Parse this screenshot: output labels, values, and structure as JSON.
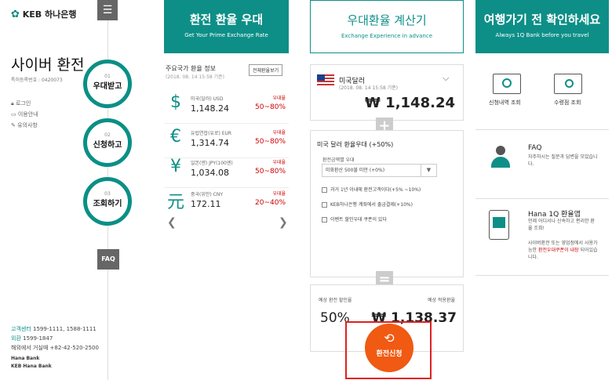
{
  "left": {
    "logo_text": "KEB 하나은행",
    "brand": "사이버 환전",
    "reg_no": "특허등록번호 : 0420073",
    "links": [
      "로그인",
      "이용안내",
      "유의사항"
    ],
    "steps": [
      {
        "num": "01",
        "label": "우대받고"
      },
      {
        "num": "02",
        "label": "신청하고"
      },
      {
        "num": "03",
        "label": "조회하기"
      }
    ],
    "faq": "FAQ",
    "contact": {
      "center_label": "고객센터",
      "center": "1599-1111, 1588-1111",
      "foreign_label": "외환",
      "foreign": "1599-1847",
      "overseas": "해외에서 거실때 +82-42-520-2500"
    },
    "hana_bank": "Hana Bank",
    "keb_hana_bank": "KEB Hana Bank"
  },
  "exchange": {
    "title": "환전 환율 우대",
    "subtitle": "Get Your Prime Exchange Rate",
    "rate_title": "주요국가 환율 정보",
    "rate_date": "(2018. 08. 14 15:58 기준)",
    "all_button": "전체환율보기",
    "rates": [
      {
        "symbol": "$",
        "currency": "미국(달러) USD",
        "value": "1,148.24",
        "label": "우대율",
        "pct": "50~80%"
      },
      {
        "symbol": "€",
        "currency": "유럽연합(유로) EUR",
        "value": "1,314.74",
        "label": "우대율",
        "pct": "50~80%"
      },
      {
        "symbol": "¥",
        "currency": "일본(엔) JPY(100엔)",
        "value": "1,034.08",
        "label": "우대율",
        "pct": "50~80%"
      },
      {
        "symbol": "元",
        "currency": "중국(위안) CNY",
        "value": "172.11",
        "label": "우대율",
        "pct": "20~40%"
      }
    ]
  },
  "calc": {
    "title": "우대환율 계산기",
    "subtitle": "Exchange Experience in advance",
    "currency": "미국달러",
    "date": "(2018. 08. 14 15:58 기준)",
    "rate": "₩ 1,148.24",
    "section_title": "미국 달러 환율우대 (+50%)",
    "amount_label": "환전금액별 우대",
    "select_value": "미화환산 500불 미만 (+0%)",
    "options": [
      "과거 1년 이내에 환전고객이다(+5% ~10%)",
      "KEB하나은행 계좌에서 출금결제(+10%)",
      "이벤트 할인우대 쿠폰이 있다"
    ],
    "discount_label": "예상 환전 할인율",
    "applied_label": "예상 적용환율",
    "discount": "50%",
    "applied": "₩ 1,138.37",
    "apply_button": "환전신청"
  },
  "right": {
    "title": "여행가기 전 확인하세요",
    "subtitle": "Always 1Q Bank before you travel",
    "menu": [
      "신청내역 조회",
      "수령점 조회"
    ],
    "faq_title": "FAQ",
    "faq_desc": "자주하시는 질문과 답변을 모았습니다.",
    "app_title": "Hana 1Q 환율앱",
    "app_desc": "언제 어디서나 신속하고 편리한 환율 조회!",
    "app_desc2_a": "사이버환전 또는 영업점에서 사용가능한 ",
    "app_desc2_hl": "환전우대쿠폰이 내장",
    "app_desc2_b": " 되어있습니다."
  },
  "colors": {
    "teal": "#0d8f87",
    "orange": "#f05a12",
    "red": "#cc0000"
  }
}
